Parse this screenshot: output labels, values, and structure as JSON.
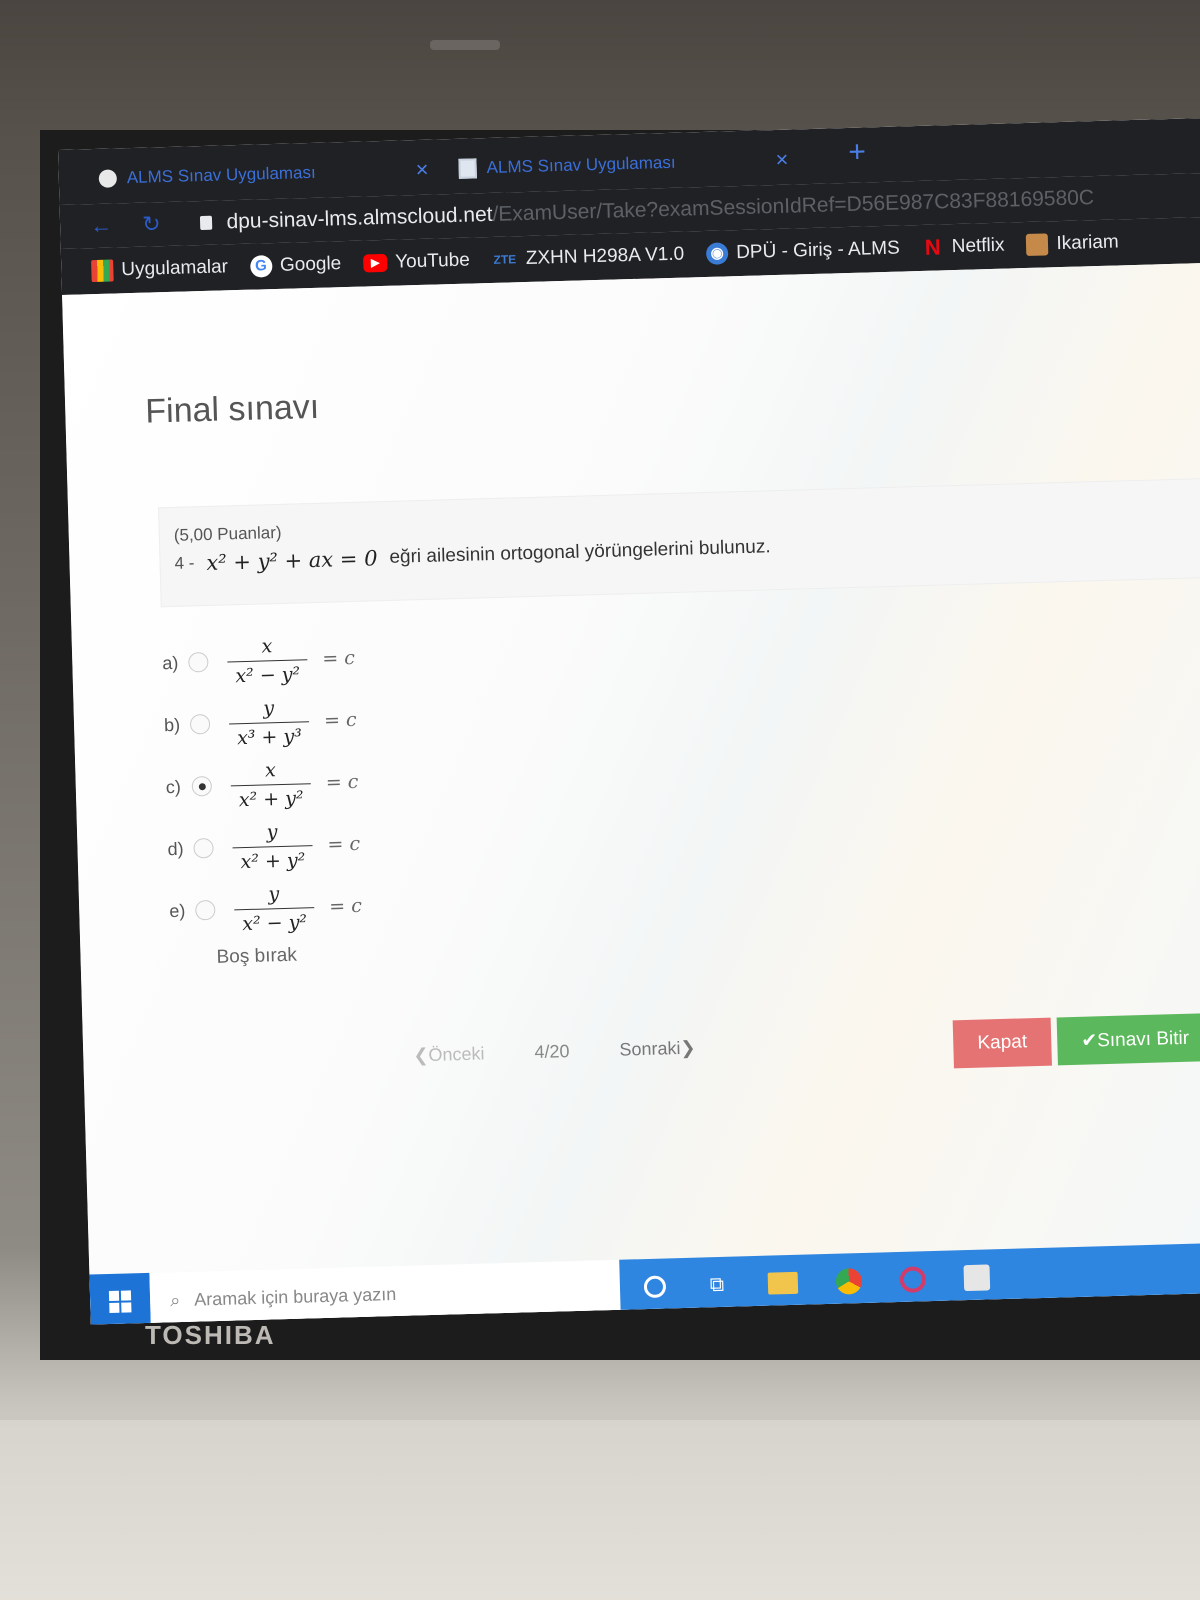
{
  "browser": {
    "tabs": [
      {
        "label": "ALMS Sınav Uygulaması",
        "close": "×"
      },
      {
        "label": "ALMS Sınav Uygulaması",
        "close": "×"
      }
    ],
    "new_tab": "+",
    "url_host": "dpu-sinav-lms.almscloud.net",
    "url_path": "/ExamUser/Take?examSessionIdRef=D56E987C83F88169580C",
    "bookmarks": [
      {
        "label": "Uygulamalar",
        "icon": "apps-grid-icon"
      },
      {
        "label": "Google",
        "icon": "google-icon",
        "glyph": "G"
      },
      {
        "label": "YouTube",
        "icon": "youtube-icon",
        "glyph": "▶"
      },
      {
        "label": "ZXHN H298A V1.0",
        "icon": "zte-icon",
        "glyph": "ZTE"
      },
      {
        "label": "DPÜ - Giriş - ALMS",
        "icon": "globe-icon",
        "glyph": "◉"
      },
      {
        "label": "Netflix",
        "icon": "netflix-icon",
        "glyph": "N"
      },
      {
        "label": "Ikariam",
        "icon": "ikariam-icon",
        "glyph": ""
      }
    ]
  },
  "exam": {
    "title": "Final sınavı",
    "question": {
      "points": "(5,00 Puanlar)",
      "number": "4 -",
      "equation": "x² + y² + ax = 0",
      "text": "eğri ailesinin ortogonal yörüngelerini bulunuz."
    },
    "options": [
      {
        "letter": "a)",
        "num": "x",
        "den": "x² − y²",
        "rhs": "= c",
        "selected": false
      },
      {
        "letter": "b)",
        "num": "y",
        "den": "x³ + y³",
        "rhs": "= c",
        "selected": false
      },
      {
        "letter": "c)",
        "num": "x",
        "den": "x² + y²",
        "rhs": "= c",
        "selected": true
      },
      {
        "letter": "d)",
        "num": "y",
        "den": "x² + y²",
        "rhs": "= c",
        "selected": false
      },
      {
        "letter": "e)",
        "num": "y",
        "den": "x² − y²",
        "rhs": "= c",
        "selected": false
      }
    ],
    "blank_label": "Boş bırak",
    "pager": {
      "prev": "❮Önceki",
      "page": "4/20",
      "next": "Sonraki❯"
    },
    "close_button": "Kapat",
    "finish_button": "✔Sınavı Bitir"
  },
  "taskbar": {
    "search_placeholder": "Aramak için buraya yazın"
  },
  "device": {
    "brand": "TOSHIBA"
  },
  "colors": {
    "close_button": "#e57373",
    "finish_button": "#5cb85c",
    "taskbar": "#2f86e0"
  }
}
